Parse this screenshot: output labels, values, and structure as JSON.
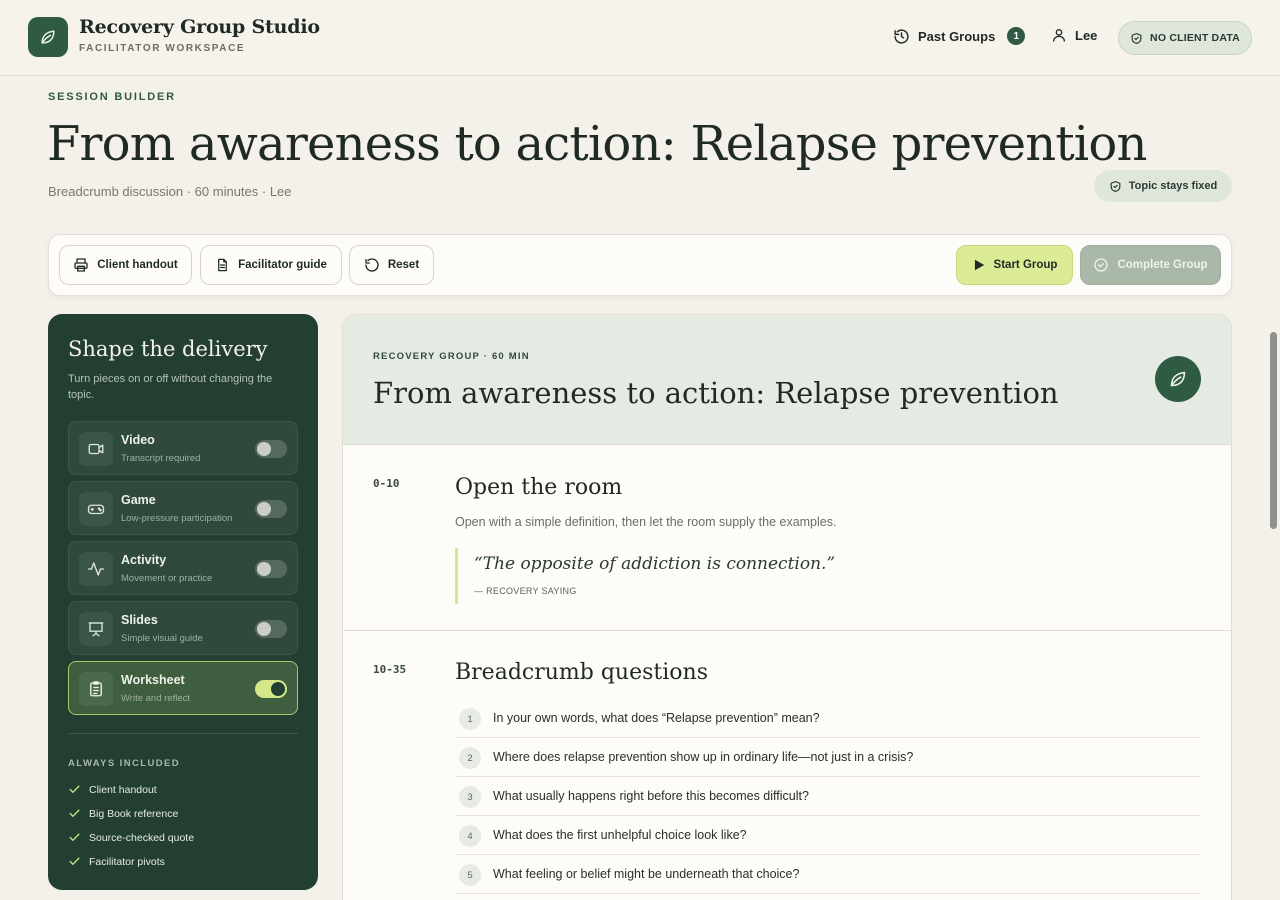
{
  "header": {
    "brand_title": "Recovery Group Studio",
    "brand_subtitle": "FACILITATOR WORKSPACE",
    "past_groups_label": "Past Groups",
    "past_groups_count": "1",
    "user_name": "Lee",
    "privacy_badge": "NO CLIENT DATA"
  },
  "page": {
    "eyebrow": "SESSION BUILDER",
    "title": "From awareness to action: Relapse prevention",
    "meta": "Breadcrumb discussion · 60 minutes · Lee",
    "topic_badge": "Topic stays fixed"
  },
  "toolbar": {
    "client_handout": "Client handout",
    "facilitator_guide": "Facilitator guide",
    "reset": "Reset",
    "start_group": "Start Group",
    "complete_group": "Complete Group"
  },
  "sidebar": {
    "title": "Shape the delivery",
    "description": "Turn pieces on or off without changing the topic.",
    "options": [
      {
        "label": "Video",
        "sub": "Transcript required",
        "icon": "video-icon",
        "on": false
      },
      {
        "label": "Game",
        "sub": "Low-pressure participation",
        "icon": "gamepad-icon",
        "on": false
      },
      {
        "label": "Activity",
        "sub": "Movement or practice",
        "icon": "activity-icon",
        "on": false
      },
      {
        "label": "Slides",
        "sub": "Simple visual guide",
        "icon": "presentation-icon",
        "on": false
      },
      {
        "label": "Worksheet",
        "sub": "Write and reflect",
        "icon": "clipboard-icon",
        "on": true
      }
    ],
    "always_title": "ALWAYS INCLUDED",
    "always_items": [
      "Client handout",
      "Big Book reference",
      "Source-checked quote",
      "Facilitator pivots"
    ]
  },
  "session": {
    "eyebrow": "RECOVERY GROUP · 60 MIN",
    "title": "From awareness to action: Relapse prevention",
    "sections": [
      {
        "time": "0-10",
        "title": "Open the room",
        "text": "Open with a simple definition, then let the room supply the examples.",
        "quote": "“The opposite of addiction is connection.”",
        "quote_attr": "— RECOVERY SAYING"
      },
      {
        "time": "10-35",
        "title": "Breadcrumb questions",
        "questions": [
          {
            "num": "1",
            "text": "In your own words, what does “Relapse prevention” mean?"
          },
          {
            "num": "2",
            "text": "Where does relapse prevention show up in ordinary life—not just in a crisis?"
          },
          {
            "num": "3",
            "text": "What usually happens right before this becomes difficult?"
          },
          {
            "num": "4",
            "text": "What does the first unhelpful choice look like?"
          },
          {
            "num": "5",
            "text": "What feeling or belief might be underneath that choice?"
          }
        ]
      }
    ]
  },
  "colors": {
    "brand_green": "#2f5a43",
    "sidebar_bg": "#233f31",
    "accent_lime": "#dcec96",
    "page_bg": "#f4f1ea"
  }
}
